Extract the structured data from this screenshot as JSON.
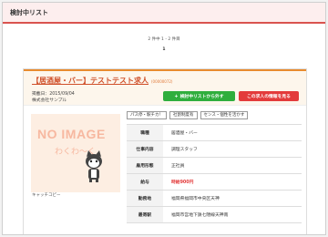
{
  "header": {
    "title": "検討中リスト"
  },
  "pager": {
    "info": "2 件中 1 - 2 件目",
    "page": "1"
  },
  "job": {
    "title": "【居酒屋・バー】テストテスト求人",
    "code": "(00000072)",
    "posted": "掲載日：2015/09/04",
    "company": "株式会社サンプル",
    "remove_label": "検討中リストから外す",
    "detail_label": "この求人の情報を見る",
    "tags": [
      "パス停・駅チカ！",
      "社割制度有",
      "センス・個性を活かす"
    ],
    "image": {
      "big": "NO IMAGE",
      "small": "わくわ〜く"
    },
    "catch_copy": "キャッチコピー",
    "details": [
      {
        "label": "職種",
        "value": "居酒屋・バー"
      },
      {
        "label": "仕事内容",
        "value": "調理スタッフ"
      },
      {
        "label": "雇用形態",
        "value": "正社員"
      },
      {
        "label": "給与",
        "value": "時給900円"
      },
      {
        "label": "勤務地",
        "value": "福岡県福岡市中央区天神"
      },
      {
        "label": "最寄駅",
        "value": "福岡市営地下鉄七隈線天神南"
      }
    ]
  },
  "colors": {
    "accent_red": "#d9534f",
    "green": "#2fae3d",
    "red": "#e33b3b",
    "orange": "#e88b2e"
  }
}
